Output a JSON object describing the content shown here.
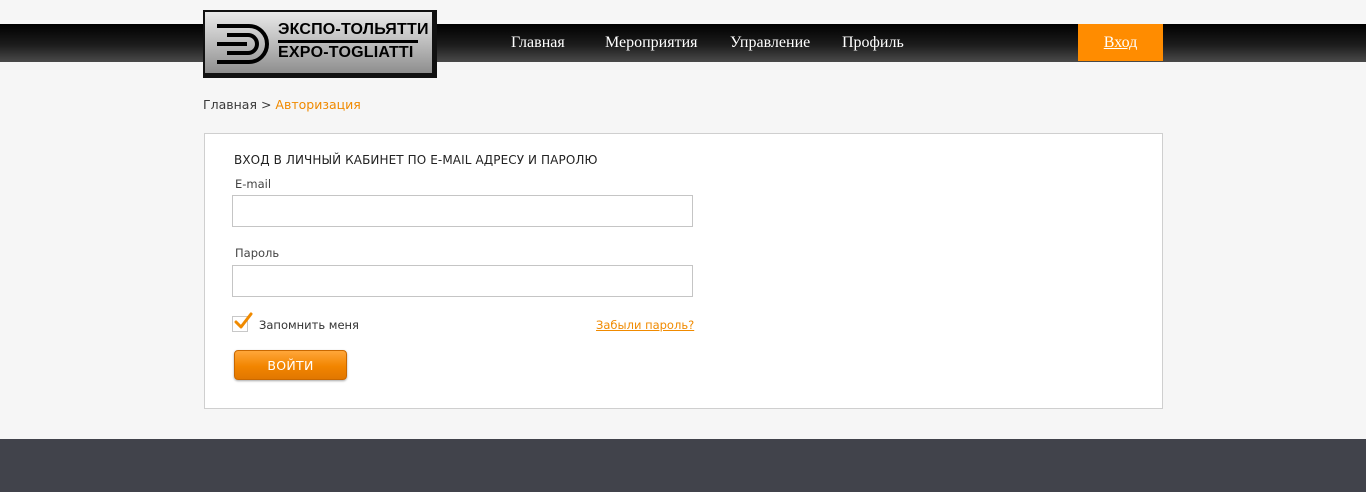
{
  "header": {
    "logo_ru": "ЭКСПО-ТОЛЬЯТТИ",
    "logo_en": "EXPO-TOGLIATTI",
    "nav": [
      {
        "label": "Главная"
      },
      {
        "label": "Мероприятия"
      },
      {
        "label": "Управление"
      },
      {
        "label": "Профиль"
      }
    ],
    "login_label": "Вход"
  },
  "breadcrumb": {
    "home": "Главная",
    "separator": " > ",
    "current": "Авторизация"
  },
  "form": {
    "title": "ВХОД В ЛИЧНЫЙ КАБИНЕТ ПО E-MAIL АДРЕСУ И ПАРОЛЮ",
    "email_label": "E-mail",
    "email_value": "",
    "password_label": "Пароль",
    "password_value": "",
    "remember_label": "Запомнить меня",
    "remember_checked": true,
    "forgot_label": "Забыли пароль?",
    "submit_label": "ВОЙТИ"
  },
  "colors": {
    "accent": "#ff8c00",
    "link": "#f08a00",
    "footer": "#41434b",
    "header_band": "#000000"
  },
  "icons": [
    "logo-mark-icon",
    "checkmark-icon"
  ]
}
